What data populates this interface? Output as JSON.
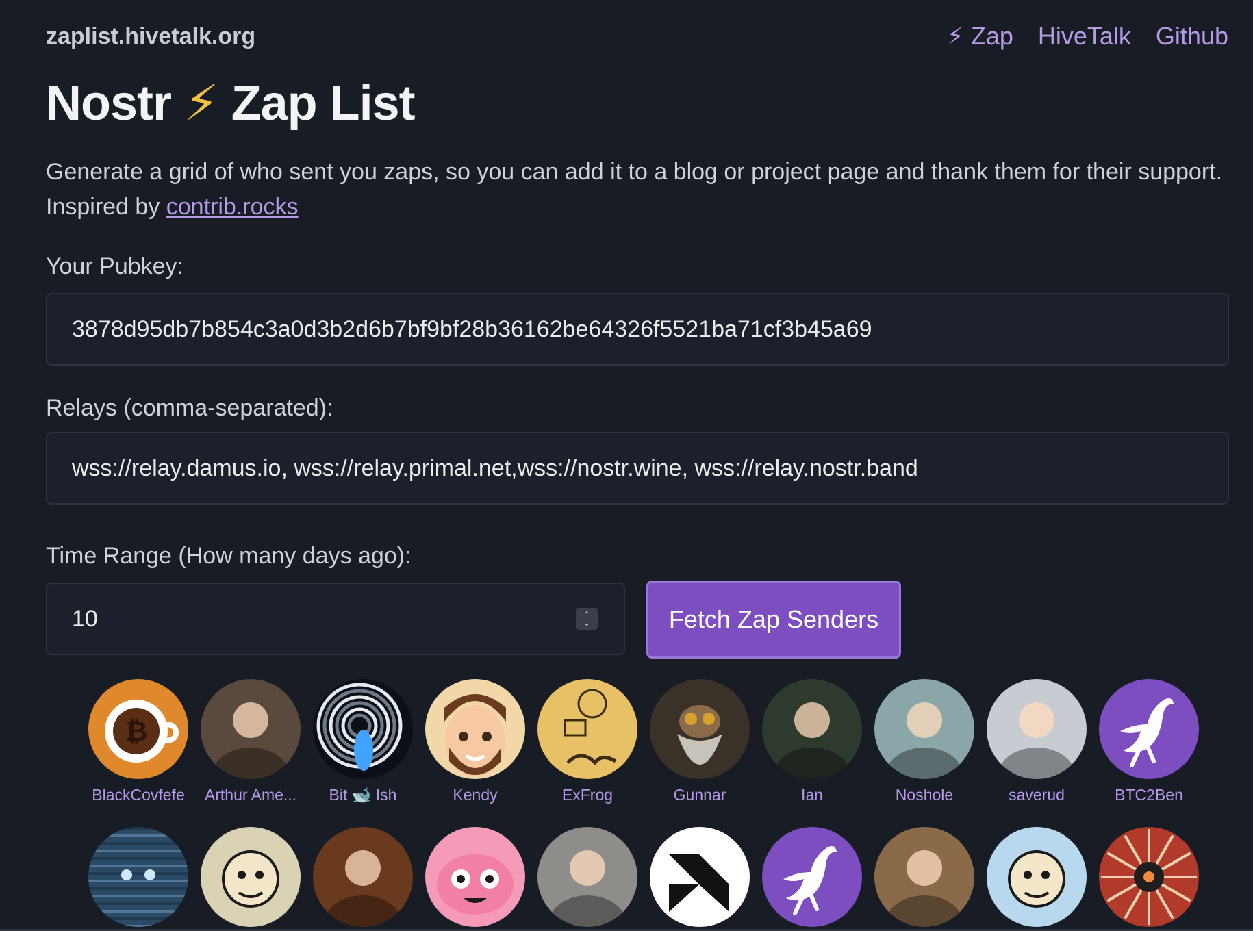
{
  "header": {
    "site_name": "zaplist.hivetalk.org",
    "nav": [
      {
        "label": "⚡ Zap"
      },
      {
        "label": "HiveTalk"
      },
      {
        "label": "Github"
      }
    ]
  },
  "page": {
    "title_left": "Nostr",
    "title_icon": "⚡",
    "title_right": "Zap List",
    "intro_text": "Generate a grid of who sent you zaps, so you can add it to a blog or project page and thank them for their support. Inspired by ",
    "intro_link": "contrib.rocks"
  },
  "form": {
    "pubkey_label": "Your Pubkey:",
    "pubkey_value": "3878d95db7b854c3a0d3b2d6b7bf9bf28b36162be64326f5521ba71cf3b45a69",
    "relays_label": "Relays (comma-separated):",
    "relays_value": "wss://relay.damus.io, wss://relay.primal.net,wss://nostr.wine, wss://relay.nostr.band",
    "time_range_label": "Time Range (How many days ago):",
    "time_range_value": "10",
    "fetch_button": "Fetch Zap Senders"
  },
  "senders": [
    {
      "name": "BlackCovfefe",
      "icon": "coffee-bitcoin-avatar",
      "color": "#e0892c"
    },
    {
      "name": "Arthur Ame...",
      "icon": "photo-avatar",
      "color": "#5a4a3e"
    },
    {
      "name": "Bit 🐋 Ish",
      "icon": "spiral-avatar",
      "color": "#1b2a3e"
    },
    {
      "name": "Kendy",
      "icon": "memoji-avatar",
      "color": "#f2d7a8"
    },
    {
      "name": "ExFrog",
      "icon": "sketch-avatar",
      "color": "#e8c065"
    },
    {
      "name": "Gunnar",
      "icon": "wizard-avatar",
      "color": "#3a3128"
    },
    {
      "name": "Ian",
      "icon": "photo-avatar",
      "color": "#2f3a2e"
    },
    {
      "name": "Noshole",
      "icon": "photo-avatar",
      "color": "#8aa6a8"
    },
    {
      "name": "saverud",
      "icon": "photo-avatar",
      "color": "#c7ccd3"
    },
    {
      "name": "BTC2Ben",
      "icon": "ostrich-avatar",
      "color": "#7d4ec0"
    },
    {
      "name": "",
      "icon": "glitch-avatar",
      "color": "#2b4a66"
    },
    {
      "name": "",
      "icon": "cartoon-avatar",
      "color": "#d9d2b4"
    },
    {
      "name": "",
      "icon": "photo-avatar",
      "color": "#6a3a1e"
    },
    {
      "name": "",
      "icon": "monster-avatar",
      "color": "#f39bb8"
    },
    {
      "name": "",
      "icon": "photo-avatar",
      "color": "#8f8d8a"
    },
    {
      "name": "",
      "icon": "geometric-avatar",
      "color": "#ffffff"
    },
    {
      "name": "",
      "icon": "ostrich-avatar",
      "color": "#7d4ec0"
    },
    {
      "name": "",
      "icon": "photo-avatar",
      "color": "#8b6a4a"
    },
    {
      "name": "",
      "icon": "cartoon-avatar",
      "color": "#b8d8ee"
    },
    {
      "name": "",
      "icon": "mandala-avatar",
      "color": "#b23a2a"
    }
  ]
}
